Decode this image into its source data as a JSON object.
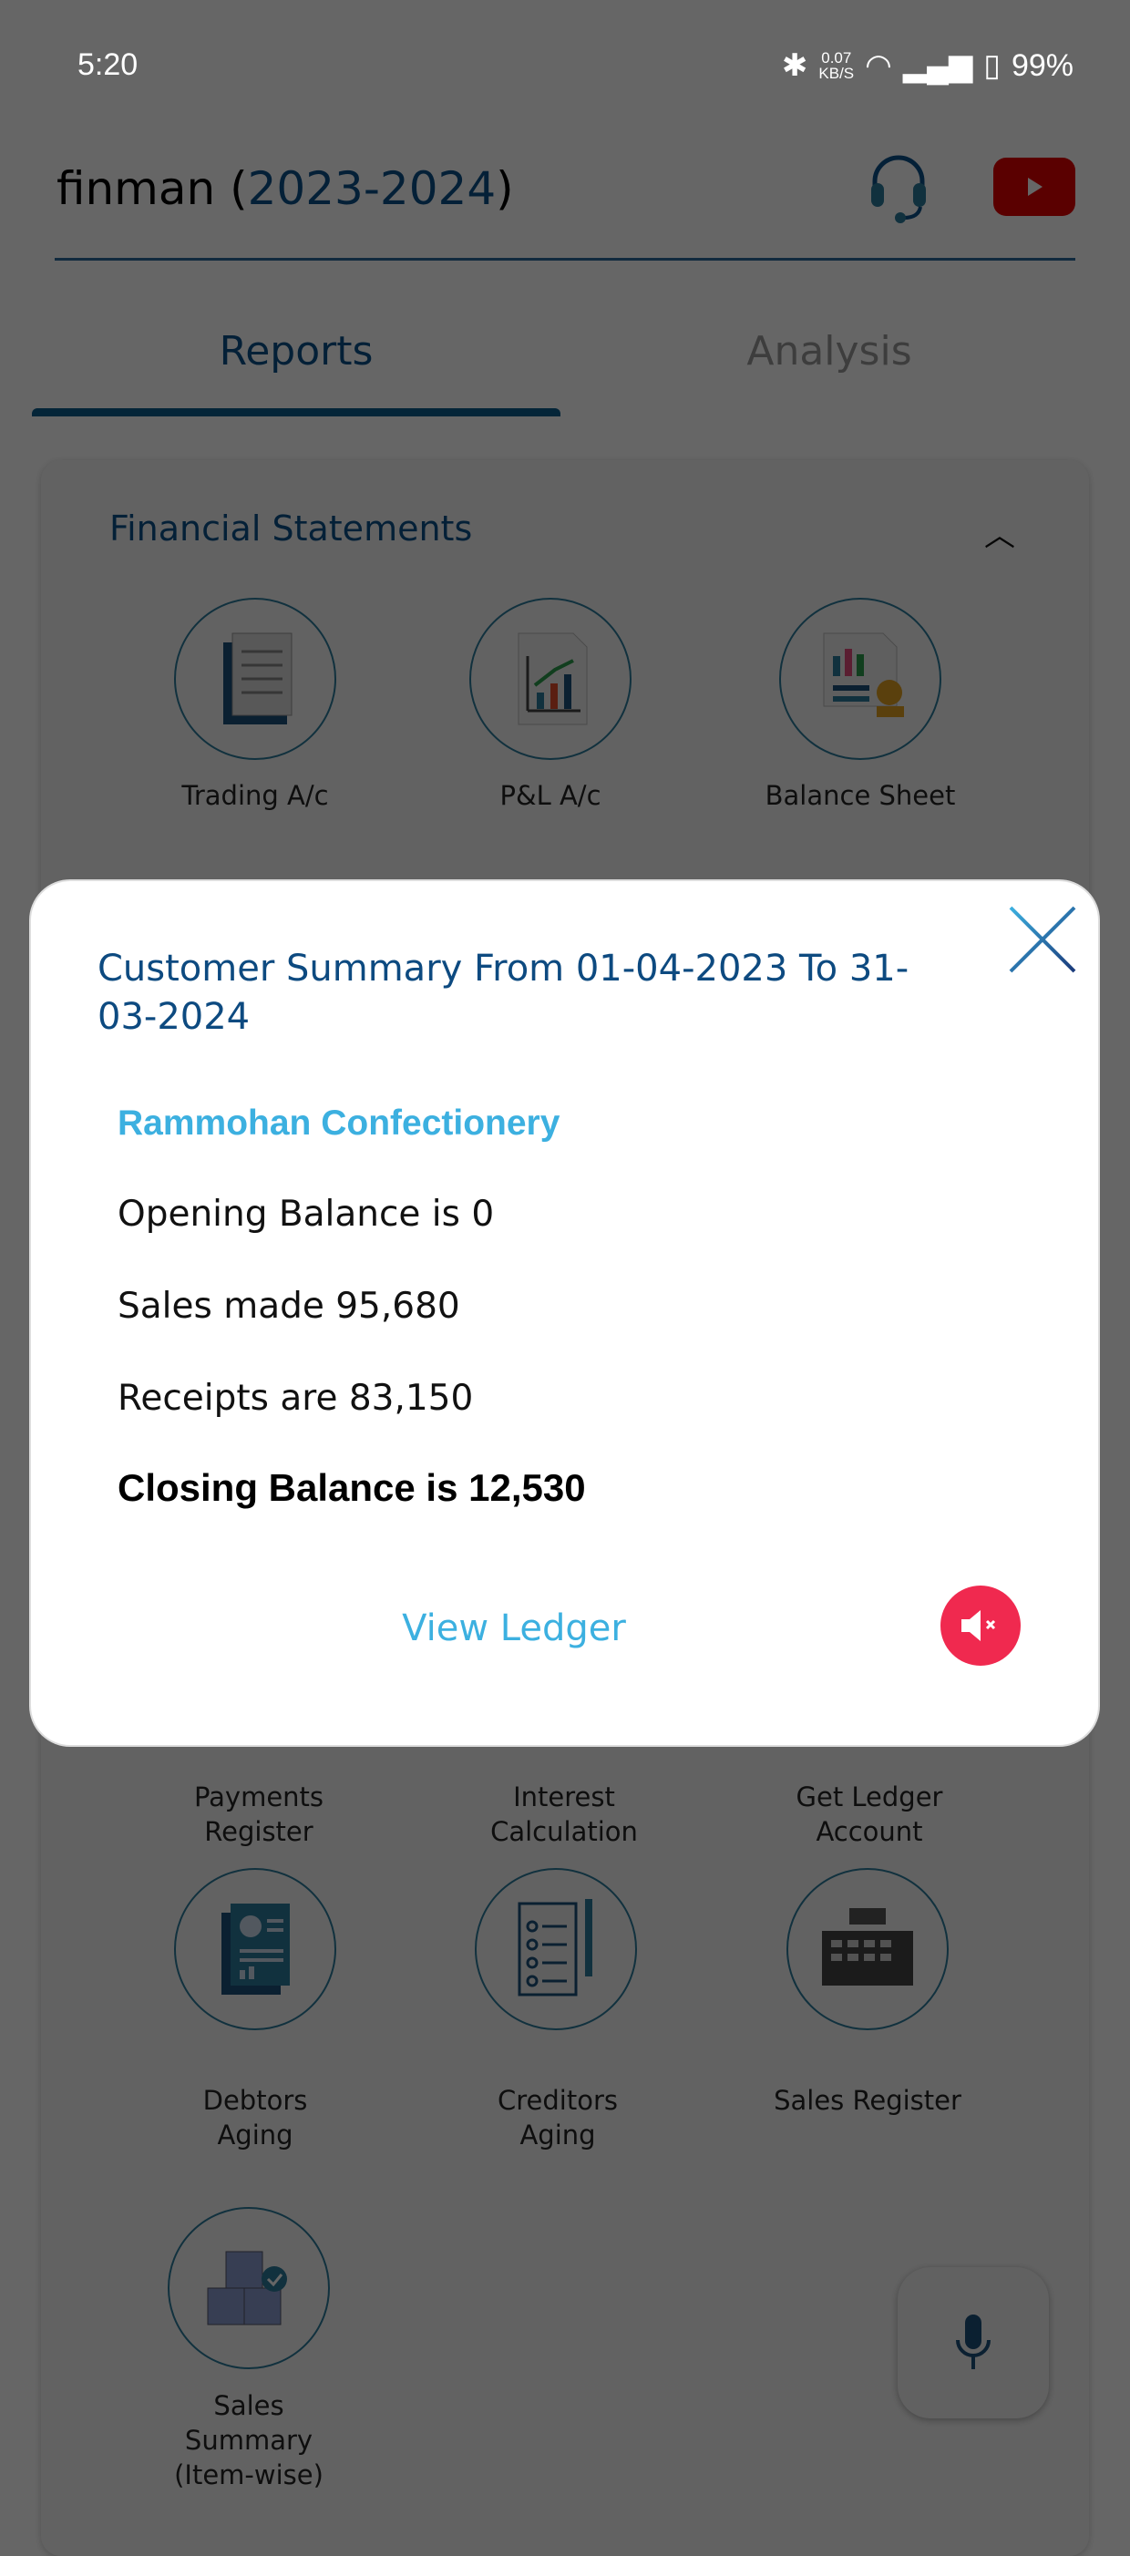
{
  "status_bar": {
    "time": "5:20",
    "net_speed": "0.07",
    "net_unit": "KB/S",
    "battery": "99%"
  },
  "header": {
    "app_name": "finman (",
    "year": "2023-2024",
    "close_paren": ")"
  },
  "tabs": [
    {
      "label": "Reports",
      "active": true
    },
    {
      "label": "Analysis",
      "active": false
    }
  ],
  "section": {
    "title": "Financial Statements"
  },
  "reports": [
    {
      "label": "Trading A/c",
      "icon": "document-icon"
    },
    {
      "label": "P&L A/c",
      "icon": "chart-document-icon"
    },
    {
      "label": "Balance Sheet",
      "icon": "balance-sheet-icon"
    },
    {
      "label": "Payments\nRegister"
    },
    {
      "label": "Interest\nCalculation"
    },
    {
      "label": "Get Ledger\nAccount"
    },
    {
      "label": "Debtors\nAging",
      "icon": "report-icon"
    },
    {
      "label": "Creditors\nAging",
      "icon": "checklist-icon"
    },
    {
      "label": "Sales Register",
      "icon": "cash-register-icon"
    },
    {
      "label": "Sales\nSummary\n(Item-wise)",
      "icon": "boxes-icon"
    }
  ],
  "modal": {
    "title": "Customer Summary From 01-04-2023 To 31-03-2024",
    "customer": "Rammohan Confectionery",
    "opening": "Opening Balance is 0",
    "sales": "Sales made 95,680",
    "receipts": "Receipts are 83,150",
    "closing": "Closing Balance is 12,530",
    "view_ledger": "View Ledger"
  },
  "colors": {
    "primary": "#0b4f8a",
    "accent": "#3cb0e0",
    "mute": "#f0294f",
    "youtube": "#e00000"
  }
}
